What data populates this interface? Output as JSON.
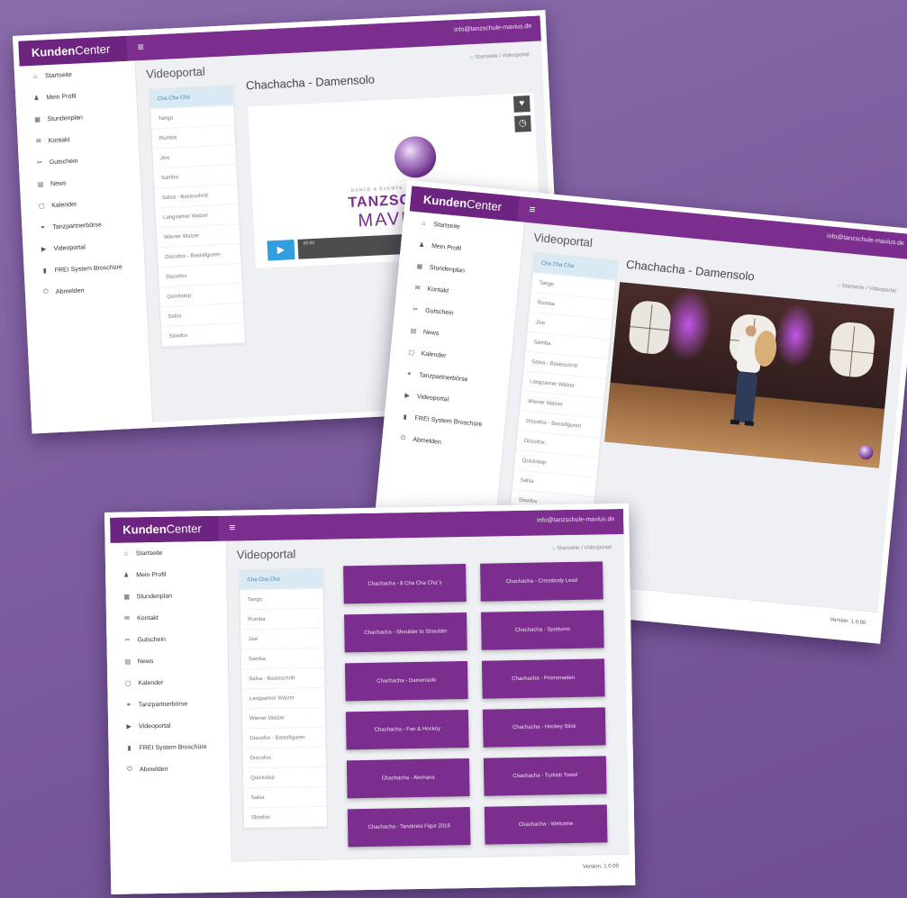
{
  "app": {
    "brand_bold": "Kunden",
    "brand_light": "Center",
    "user": "info@tanzschule-mavius.de",
    "page_title": "Videoportal",
    "breadcrumb_home": "Startseite",
    "breadcrumb_current": "Videoportal",
    "version": "Version: 1.0.00"
  },
  "sidebar": {
    "items": [
      {
        "label": "Startseite",
        "icon": "home-icon"
      },
      {
        "label": "Mein Profil",
        "icon": "user-icon"
      },
      {
        "label": "Stundenplan",
        "icon": "grid-icon"
      },
      {
        "label": "Kontakt",
        "icon": "envelope-icon"
      },
      {
        "label": "Gutschein",
        "icon": "ticket-icon"
      },
      {
        "label": "News",
        "icon": "news-icon"
      },
      {
        "label": "Kalender",
        "icon": "calendar-icon"
      },
      {
        "label": "Tanzpartnerbörse",
        "icon": "partner-icon"
      },
      {
        "label": "Videoportal",
        "icon": "video-icon"
      },
      {
        "label": "FREI System Broschüre",
        "icon": "book-icon"
      },
      {
        "label": "Abmelden",
        "icon": "logout-icon"
      }
    ]
  },
  "categories": [
    "Cha Cha Cha",
    "Tango",
    "Rumba",
    "Jive",
    "Samba",
    "Salsa - Basisschritt",
    "Langsamer Walzer",
    "Wiener Walzer",
    "Discofox - Basisfiguren",
    "Discofox",
    "Quickstep",
    "Salsa",
    "Slowfox"
  ],
  "video": {
    "title": "Chachacha - Damensolo",
    "logo_small": "DANCE & EVENTS",
    "logo_main": "TANZSCHULE",
    "logo_name": "MAVIUS",
    "time": "00:00"
  },
  "video_grid": [
    "Chachacha - 8 Cha Cha Cha´s",
    "Chachacha - Crossbody Lead",
    "Chachacha - Shoulder to Shoulder",
    "Chachacha - Spotturns",
    "Chachacha - Damensolo",
    "Chachacha - Promenaden",
    "Chachacha - Fan & Hockey",
    "Chachacha - Hockey Stick",
    "Chachacha - Alemana",
    "Chachacha - Turkish Towel",
    "Chachacha - Tanzkreis Figur 2016",
    "Chachacha - Welcome"
  ],
  "colors": {
    "purple": "#7b2e8e",
    "background": "#7c5d9f"
  }
}
